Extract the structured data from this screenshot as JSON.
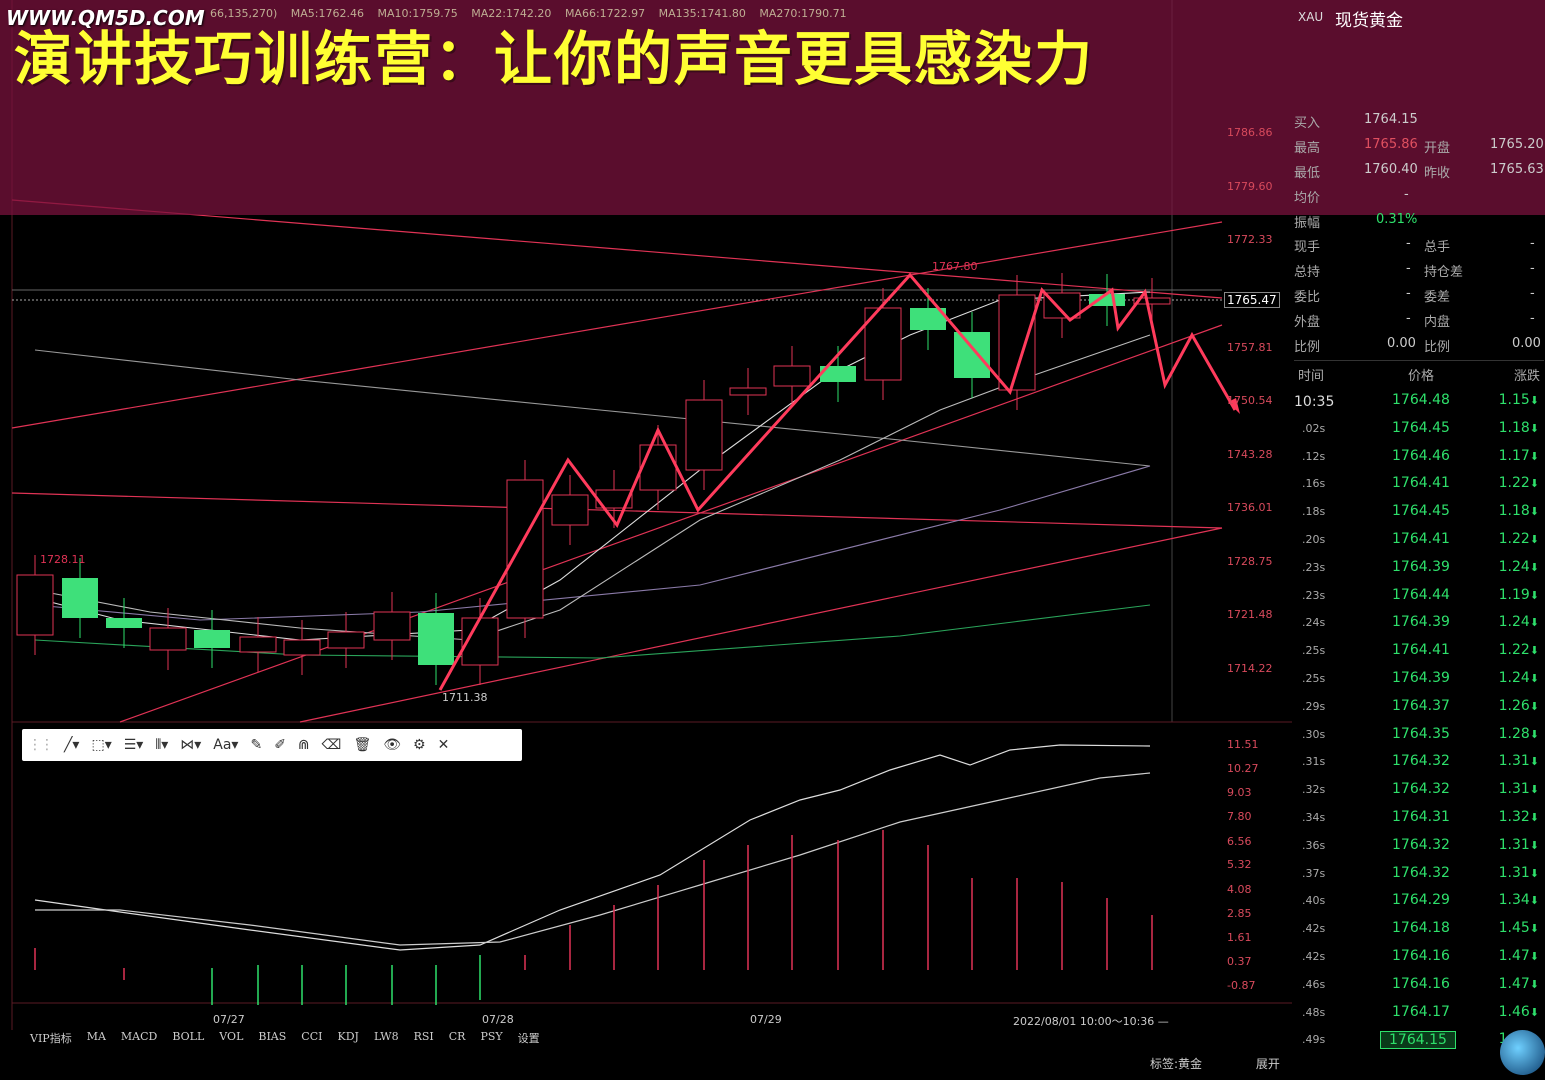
{
  "title": "演讲技巧训练营：让你的声音更具感染力",
  "watermark": "WWW.QM5D.COM",
  "ma_line": [
    "66,135,270)",
    "MA5:1762.46",
    "MA10:1759.75",
    "MA22:1742.20",
    "MA66:1722.97",
    "MA135:1741.80",
    "MA270:1790.71"
  ],
  "symbol": {
    "code": "XAU",
    "name": "现货黄金"
  },
  "price_axis": [
    "1786.86",
    "1779.60",
    "1772.33",
    "1765.47",
    "1757.81",
    "1750.54",
    "1743.28",
    "1736.01",
    "1728.75",
    "1721.48",
    "1714.22"
  ],
  "price_annotations": {
    "high": "1767.80",
    "low": "1711.38",
    "left": "1728.11",
    "current": "1765.47",
    "current2": "1764.15"
  },
  "indicator_axis": [
    "11.51",
    "10.27",
    "9.03",
    "7.80",
    "6.56",
    "5.32",
    "4.08",
    "2.85",
    "1.61",
    "0.37",
    "-0.87"
  ],
  "dates": [
    "07/27",
    "07/28",
    "07/29",
    "2022/08/01 10:00～10:36 —"
  ],
  "toolbar": {
    "font_label": "Aa"
  },
  "bottom_tabs": [
    "VIP指标",
    "MA",
    "MACD",
    "BOLL",
    "VOL",
    "BIAS",
    "CCI",
    "KDJ",
    "LW8",
    "RSI",
    "CR",
    "PSY",
    "设置"
  ],
  "quote": {
    "buy_label": "买入",
    "buy": "1764.15",
    "high_label": "最高",
    "high": "1765.86",
    "open_label": "开盘",
    "open": "1765.20",
    "low_label": "最低",
    "low": "1760.40",
    "prev_label": "昨收",
    "prev": "1765.63",
    "avg_label": "均价",
    "avg": "-",
    "amp_label": "振幅",
    "amp": "0.31%",
    "vol_label": "现手",
    "vol": "-",
    "total_label": "总手",
    "total": "-",
    "sum_label": "总持",
    "sum": "-",
    "oi_label": "持仓差",
    "oi": "-",
    "ratio_label": "委比",
    "ratio": "-",
    "diff_label": "委差",
    "diff": "-",
    "out_label": "外盘",
    "out": "-",
    "in_label": "内盘",
    "in": "-",
    "pct_label": "比例",
    "pct": "0.00",
    "pct2_label": "比例",
    "pct2": "0.00"
  },
  "ticks_header": {
    "time": "时间",
    "price": "价格",
    "change": "涨跌"
  },
  "ticks": [
    {
      "t": "10:35",
      "p": "1764.48",
      "c": "1.15"
    },
    {
      "t": ".02s",
      "p": "1764.45",
      "c": "1.18"
    },
    {
      "t": ".12s",
      "p": "1764.46",
      "c": "1.17"
    },
    {
      "t": ".16s",
      "p": "1764.41",
      "c": "1.22"
    },
    {
      "t": ".18s",
      "p": "1764.45",
      "c": "1.18"
    },
    {
      "t": ".20s",
      "p": "1764.41",
      "c": "1.22"
    },
    {
      "t": ".23s",
      "p": "1764.39",
      "c": "1.24"
    },
    {
      "t": ".23s",
      "p": "1764.44",
      "c": "1.19"
    },
    {
      "t": ".24s",
      "p": "1764.39",
      "c": "1.24"
    },
    {
      "t": ".25s",
      "p": "1764.41",
      "c": "1.22"
    },
    {
      "t": ".25s",
      "p": "1764.39",
      "c": "1.24"
    },
    {
      "t": ".29s",
      "p": "1764.37",
      "c": "1.26"
    },
    {
      "t": ".30s",
      "p": "1764.35",
      "c": "1.28"
    },
    {
      "t": ".31s",
      "p": "1764.32",
      "c": "1.31"
    },
    {
      "t": ".32s",
      "p": "1764.32",
      "c": "1.31"
    },
    {
      "t": ".34s",
      "p": "1764.31",
      "c": "1.32"
    },
    {
      "t": ".36s",
      "p": "1764.32",
      "c": "1.31"
    },
    {
      "t": ".37s",
      "p": "1764.32",
      "c": "1.31"
    },
    {
      "t": ".40s",
      "p": "1764.29",
      "c": "1.34"
    },
    {
      "t": ".42s",
      "p": "1764.18",
      "c": "1.45"
    },
    {
      "t": ".42s",
      "p": "1764.16",
      "c": "1.47"
    },
    {
      "t": ".46s",
      "p": "1764.16",
      "c": "1.47"
    },
    {
      "t": ".48s",
      "p": "1764.17",
      "c": "1.46"
    },
    {
      "t": ".49s",
      "p": "1764.15",
      "c": "1.48"
    }
  ],
  "footer": {
    "tag": "标签:黄金",
    "expand": "展开"
  }
}
